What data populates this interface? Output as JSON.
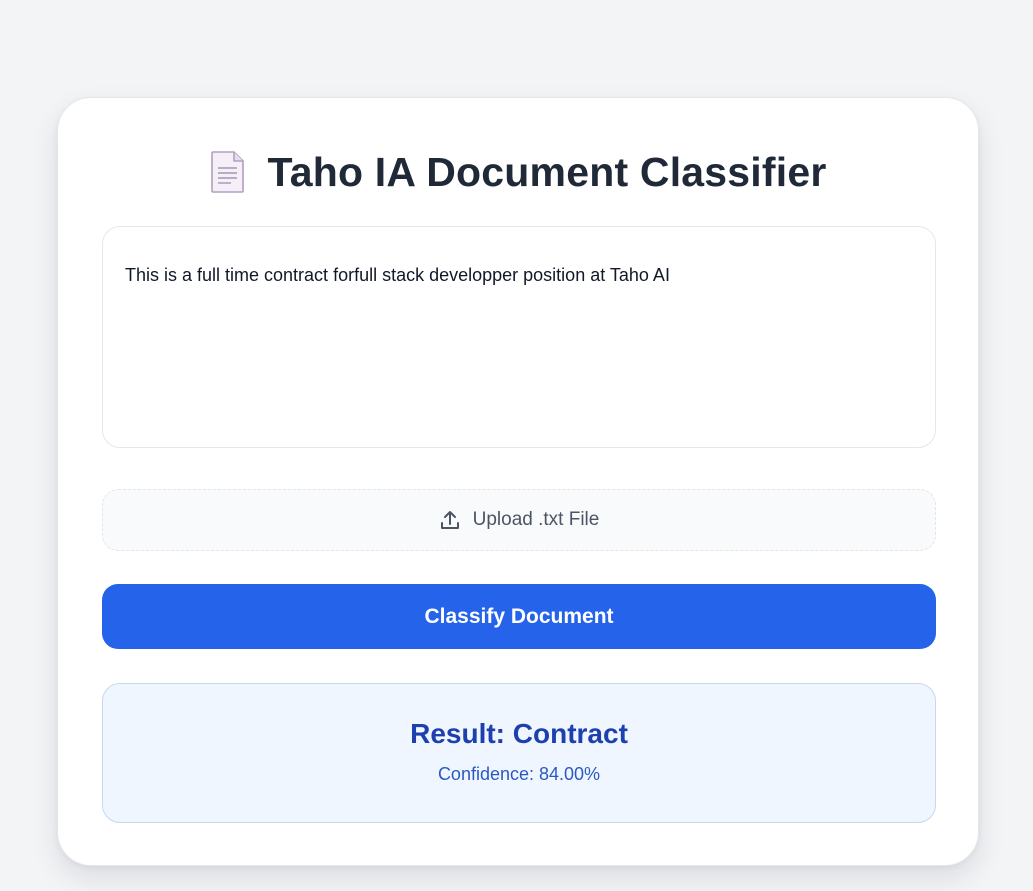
{
  "header": {
    "title": "Taho IA Document Classifier",
    "icon": "document-icon"
  },
  "document_input": {
    "value": "This is a full time contract forfull stack developper position at Taho AI"
  },
  "upload": {
    "label": "Upload .txt File",
    "icon": "upload-icon"
  },
  "classify_button": {
    "label": "Classify Document",
    "color": "#2563eb"
  },
  "result": {
    "title": "Result: Contract",
    "confidence_text": "Confidence: 84.00%",
    "background": "#eff6ff",
    "text_color": "#1e40af"
  }
}
